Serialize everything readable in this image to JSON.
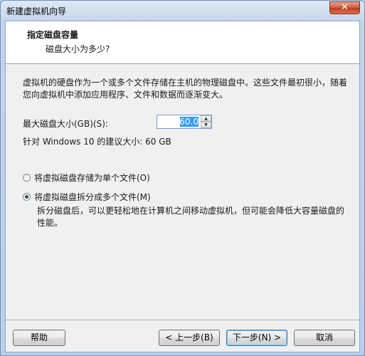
{
  "window": {
    "title": "新建虚拟机向导",
    "close_label": "✕"
  },
  "header": {
    "title": "指定磁盘容量",
    "subtitle": "磁盘大小为多少?"
  },
  "description": "虚拟机的硬盘作为一个或多个文件存储在主机的物理磁盘中。这些文件最初很小，随着您向虚拟机中添加应用程序、文件和数据而逐渐变大。",
  "disk_size": {
    "label": "最大磁盘大小(GB)(S):",
    "value": "60.0",
    "up_glyph": "▲",
    "down_glyph": "▼"
  },
  "recommended": "针对 Windows 10 的建议大小: 60 GB",
  "options": {
    "single_file": {
      "label": "将虚拟磁盘存储为单个文件(O)",
      "checked": false
    },
    "split_files": {
      "label": "将虚拟磁盘拆分成多个文件(M)",
      "checked": true
    },
    "split_description": "拆分磁盘后，可以更轻松地在计算机之间移动虚拟机，但可能会降低大容量磁盘的性能。"
  },
  "buttons": {
    "help": "帮助",
    "back": "< 上一步(B)",
    "next": "下一步(N) >",
    "cancel": "取消"
  }
}
